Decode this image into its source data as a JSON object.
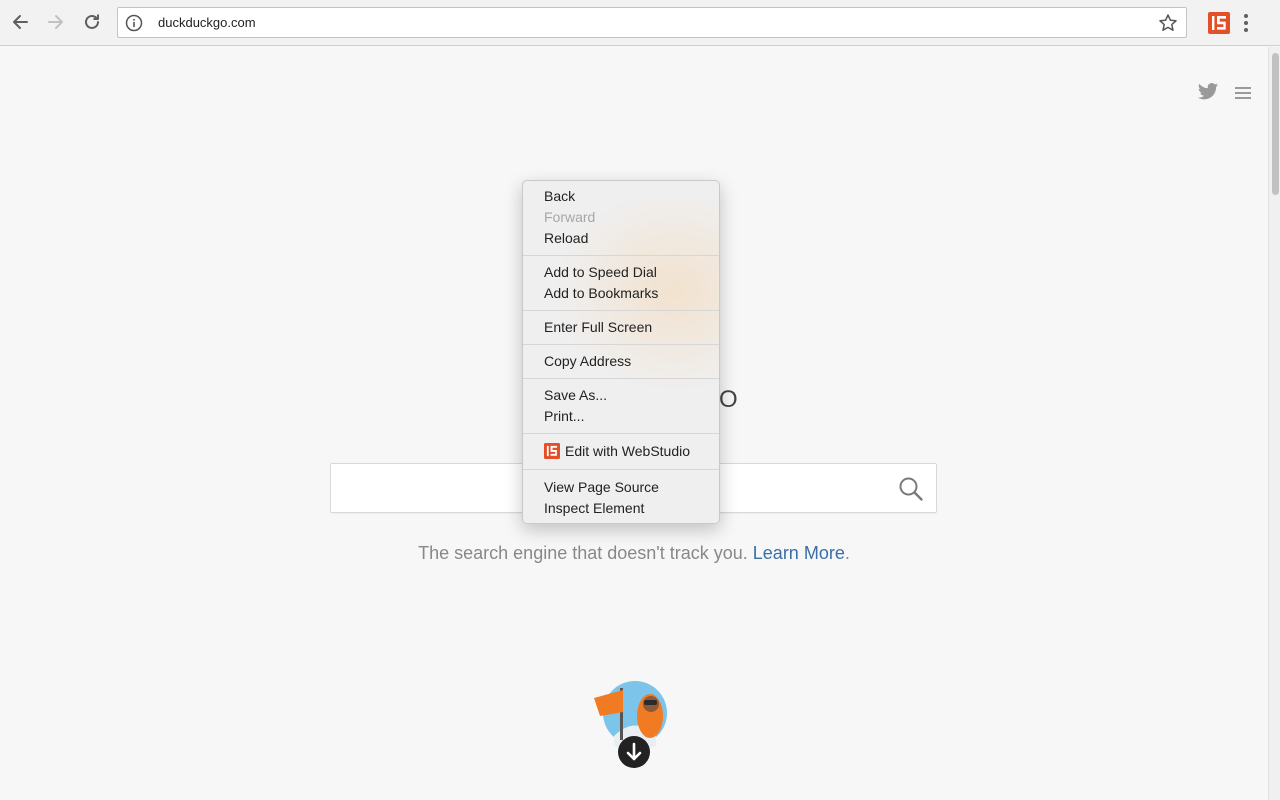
{
  "browser": {
    "url": "duckduckgo.com"
  },
  "page": {
    "logo_fragment": "O",
    "search_placeholder": "",
    "tagline": "The search engine that doesn't track you.",
    "learn_more": "Learn More",
    "tagline_end": "."
  },
  "context_menu": {
    "items": [
      {
        "label": "Back",
        "enabled": true
      },
      {
        "label": "Forward",
        "enabled": false
      },
      {
        "label": "Reload",
        "enabled": true
      },
      {
        "label": "Add to Speed Dial",
        "enabled": true
      },
      {
        "label": "Add to Bookmarks",
        "enabled": true
      },
      {
        "label": "Enter Full Screen",
        "enabled": true
      },
      {
        "label": "Copy Address",
        "enabled": true
      },
      {
        "label": "Save As...",
        "enabled": true
      },
      {
        "label": "Print...",
        "enabled": true
      },
      {
        "label": "Edit with WebStudio",
        "enabled": true,
        "icon": "html5-icon"
      },
      {
        "label": "View Page Source",
        "enabled": true
      },
      {
        "label": "Inspect Element",
        "enabled": true
      }
    ]
  },
  "colors": {
    "link": "#3a6ea5",
    "html5_orange": "#e34f26",
    "mascot_orange": "#f07b23"
  },
  "icons": [
    "back-arrow-icon",
    "forward-arrow-icon",
    "reload-icon",
    "info-icon",
    "star-icon",
    "html5-icon",
    "more-vert-icon",
    "twitter-icon",
    "hamburger-icon",
    "search-icon",
    "down-arrow-icon"
  ]
}
